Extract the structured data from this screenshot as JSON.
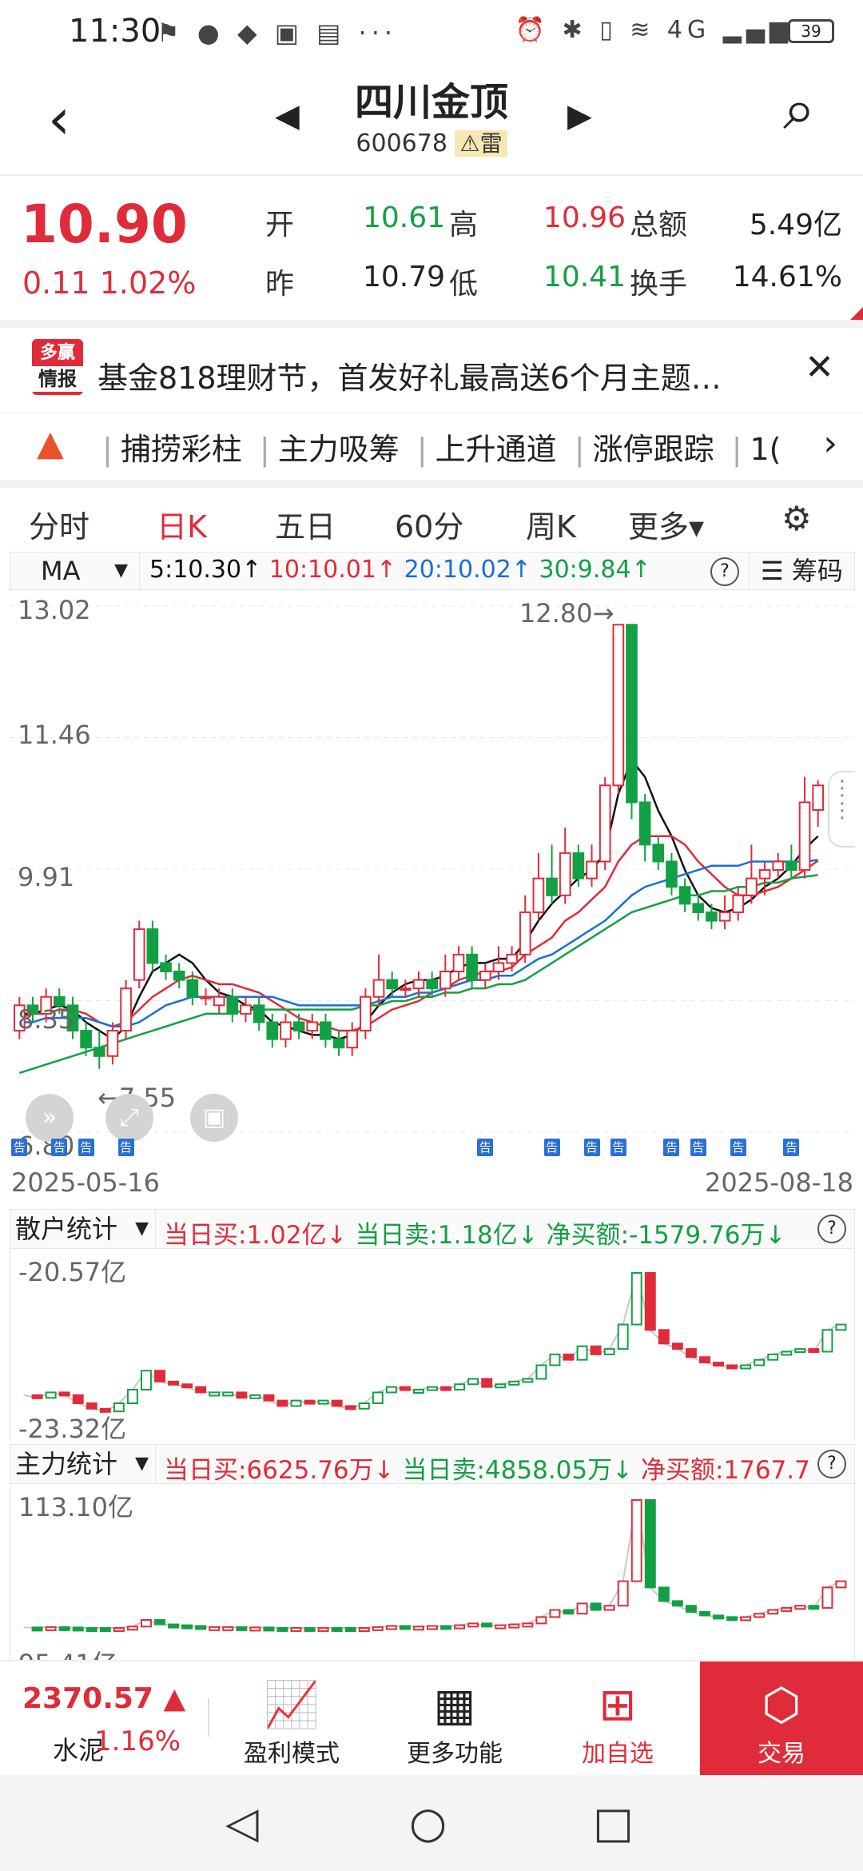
{
  "status_bar": {
    "time": "11:30",
    "battery": "39",
    "left_icons": "⚑ ● ◆ ▣ ▤ ···",
    "right_icons": "⏰ ✱ ▯ ≋ 4G ▂▄▆"
  },
  "header": {
    "back": "‹",
    "prev": "◀",
    "next": "▶",
    "title": "四川金顶",
    "code": "600678",
    "warning_label": "⚠雷",
    "search": "⌕"
  },
  "quote": {
    "price": "10.90",
    "change": "0.11 1.02%",
    "open_label": "开",
    "open": "10.61",
    "high_label": "高",
    "high": "10.96",
    "prev_label": "昨",
    "prev": "10.79",
    "low_label": "低",
    "low": "10.41",
    "amount_label": "总额",
    "amount": "5.49亿",
    "turnover_label": "换手",
    "turnover": "14.61%"
  },
  "ad": {
    "badge_top": "多赢",
    "badge_bottom": "情报",
    "text": "基金818理财节，首发好礼最高送6个月主题…",
    "close": "✕"
  },
  "tags": {
    "items": [
      "捕捞彩柱",
      "主力吸筹",
      "上升通道",
      "涨停跟踪",
      "1("
    ],
    "more": "›"
  },
  "tabs": [
    "分时",
    "日K",
    "五日",
    "60分",
    "周K",
    "更多▾"
  ],
  "settings_icon": "⚙",
  "ma_bar": {
    "selector": "MA",
    "ma5": "5:10.30↑",
    "ma10": "10:10.01↑",
    "ma20": "20:10.02↑",
    "ma30": "30:9.84↑",
    "help": "?",
    "chip": "筹码"
  },
  "chart_data": {
    "type": "candlestick",
    "ylim": [
      6.8,
      13.02
    ],
    "y_ticks": [
      "13.02",
      "11.46",
      "9.91",
      "8.35",
      "6.80"
    ],
    "max_label": "12.80→",
    "min_label": "←7.55",
    "x_start": "2025-05-16",
    "x_end": "2025-08-18",
    "candles": [
      [
        8.0,
        8.3,
        7.9,
        8.4
      ],
      [
        8.3,
        8.2,
        8.1,
        8.4
      ],
      [
        8.2,
        8.4,
        8.1,
        8.5
      ],
      [
        8.4,
        8.3,
        8.2,
        8.5
      ],
      [
        8.3,
        8.0,
        7.9,
        8.4
      ],
      [
        8.0,
        7.8,
        7.7,
        8.1
      ],
      [
        7.8,
        7.7,
        7.55,
        8.0
      ],
      [
        7.7,
        8.0,
        7.6,
        8.1
      ],
      [
        8.0,
        8.5,
        7.9,
        8.6
      ],
      [
        8.6,
        9.2,
        8.5,
        9.3
      ],
      [
        9.2,
        8.8,
        8.7,
        9.3
      ],
      [
        8.8,
        8.7,
        8.6,
        8.9
      ],
      [
        8.7,
        8.6,
        8.5,
        8.8
      ],
      [
        8.6,
        8.4,
        8.3,
        8.7
      ],
      [
        8.4,
        8.4,
        8.3,
        8.5
      ],
      [
        8.3,
        8.4,
        8.2,
        8.5
      ],
      [
        8.4,
        8.2,
        8.1,
        8.5
      ],
      [
        8.2,
        8.3,
        8.1,
        8.4
      ],
      [
        8.3,
        8.1,
        8.0,
        8.4
      ],
      [
        8.1,
        7.9,
        7.8,
        8.2
      ],
      [
        7.9,
        8.1,
        7.8,
        8.2
      ],
      [
        8.1,
        8.0,
        7.9,
        8.2
      ],
      [
        8.0,
        8.1,
        7.9,
        8.2
      ],
      [
        8.1,
        7.9,
        7.8,
        8.2
      ],
      [
        7.9,
        7.8,
        7.7,
        8.0
      ],
      [
        7.8,
        8.0,
        7.7,
        8.1
      ],
      [
        8.0,
        8.4,
        7.9,
        8.5
      ],
      [
        8.4,
        8.6,
        8.3,
        8.9
      ],
      [
        8.6,
        8.5,
        8.4,
        8.7
      ],
      [
        8.5,
        8.5,
        8.4,
        8.6
      ],
      [
        8.5,
        8.6,
        8.4,
        8.7
      ],
      [
        8.6,
        8.5,
        8.4,
        8.7
      ],
      [
        8.5,
        8.7,
        8.4,
        8.9
      ],
      [
        8.7,
        8.9,
        8.6,
        9.0
      ],
      [
        8.9,
        8.6,
        8.5,
        9.0
      ],
      [
        8.6,
        8.7,
        8.5,
        8.8
      ],
      [
        8.7,
        8.8,
        8.6,
        9.0
      ],
      [
        8.8,
        8.9,
        8.7,
        9.0
      ],
      [
        8.9,
        9.4,
        8.8,
        9.6
      ],
      [
        9.4,
        9.8,
        9.3,
        10.1
      ],
      [
        9.8,
        9.6,
        9.5,
        10.2
      ],
      [
        9.6,
        10.1,
        9.5,
        10.4
      ],
      [
        10.1,
        9.8,
        9.7,
        10.2
      ],
      [
        9.8,
        10.0,
        9.7,
        10.2
      ],
      [
        10.0,
        10.9,
        9.9,
        11.0
      ],
      [
        10.9,
        12.8,
        10.8,
        12.8
      ],
      [
        12.8,
        10.7,
        10.5,
        12.8
      ],
      [
        10.7,
        10.2,
        10.0,
        10.8
      ],
      [
        10.2,
        10.0,
        9.9,
        10.3
      ],
      [
        10.0,
        9.7,
        9.6,
        10.1
      ],
      [
        9.7,
        9.5,
        9.4,
        9.8
      ],
      [
        9.5,
        9.4,
        9.3,
        9.6
      ],
      [
        9.4,
        9.3,
        9.2,
        9.5
      ],
      [
        9.3,
        9.4,
        9.2,
        9.6
      ],
      [
        9.4,
        9.6,
        9.3,
        9.7
      ],
      [
        9.6,
        9.8,
        9.5,
        10.2
      ],
      [
        9.8,
        9.9,
        9.6,
        10.0
      ],
      [
        9.9,
        10.0,
        9.8,
        10.1
      ],
      [
        10.0,
        9.9,
        9.8,
        10.2
      ],
      [
        9.9,
        10.7,
        9.8,
        11.0
      ],
      [
        10.61,
        10.9,
        10.41,
        10.96
      ]
    ],
    "ma_series": [
      {
        "name": "5",
        "color": "#111111",
        "values": [
          8.2,
          8.2,
          8.25,
          8.3,
          8.25,
          8.1,
          8.0,
          7.9,
          8.05,
          8.4,
          8.7,
          8.8,
          8.9,
          8.8,
          8.6,
          8.45,
          8.4,
          8.3,
          8.25,
          8.1,
          8.05,
          8.0,
          7.95,
          7.95,
          7.9,
          7.95,
          8.1,
          8.3,
          8.45,
          8.55,
          8.6,
          8.6,
          8.65,
          8.75,
          8.8,
          8.8,
          8.85,
          8.85,
          9.05,
          9.3,
          9.5,
          9.65,
          9.8,
          9.9,
          10.1,
          10.8,
          11.2,
          11.0,
          10.6,
          10.3,
          9.9,
          9.6,
          9.45,
          9.4,
          9.45,
          9.55,
          9.7,
          9.8,
          9.95,
          10.15,
          10.3
        ]
      },
      {
        "name": "10",
        "color": "#e02c3a",
        "values": [
          8.15,
          8.2,
          8.2,
          8.25,
          8.25,
          8.2,
          8.1,
          8.05,
          8.1,
          8.25,
          8.4,
          8.5,
          8.6,
          8.65,
          8.6,
          8.55,
          8.55,
          8.5,
          8.45,
          8.35,
          8.25,
          8.15,
          8.1,
          8.05,
          8.0,
          8.0,
          8.05,
          8.15,
          8.25,
          8.3,
          8.35,
          8.45,
          8.5,
          8.6,
          8.65,
          8.7,
          8.7,
          8.75,
          8.9,
          9.0,
          9.1,
          9.3,
          9.4,
          9.55,
          9.7,
          10.0,
          10.2,
          10.3,
          10.3,
          10.3,
          10.2,
          10.0,
          9.85,
          9.7,
          9.6,
          9.6,
          9.65,
          9.7,
          9.8,
          9.9,
          10.01
        ]
      },
      {
        "name": "20",
        "color": "#1a6fd6",
        "values": [
          8.1,
          8.1,
          8.15,
          8.15,
          8.15,
          8.15,
          8.1,
          8.05,
          8.05,
          8.1,
          8.2,
          8.3,
          8.35,
          8.4,
          8.4,
          8.4,
          8.4,
          8.4,
          8.4,
          8.4,
          8.35,
          8.3,
          8.3,
          8.3,
          8.3,
          8.3,
          8.3,
          8.35,
          8.4,
          8.4,
          8.45,
          8.45,
          8.5,
          8.55,
          8.6,
          8.6,
          8.65,
          8.65,
          8.75,
          8.85,
          8.9,
          9.0,
          9.1,
          9.2,
          9.3,
          9.45,
          9.6,
          9.7,
          9.75,
          9.8,
          9.85,
          9.9,
          9.95,
          9.95,
          9.95,
          10.0,
          10.0,
          10.0,
          10.0,
          10.0,
          10.02
        ]
      },
      {
        "name": "30",
        "color": "#13a044",
        "values": [
          7.5,
          7.55,
          7.6,
          7.65,
          7.7,
          7.75,
          7.8,
          7.85,
          7.9,
          7.95,
          8.0,
          8.05,
          8.1,
          8.15,
          8.2,
          8.2,
          8.2,
          8.25,
          8.25,
          8.25,
          8.25,
          8.25,
          8.25,
          8.25,
          8.25,
          8.25,
          8.3,
          8.3,
          8.35,
          8.35,
          8.4,
          8.4,
          8.45,
          8.45,
          8.5,
          8.5,
          8.55,
          8.55,
          8.6,
          8.7,
          8.8,
          8.9,
          9.0,
          9.1,
          9.2,
          9.3,
          9.4,
          9.45,
          9.5,
          9.55,
          9.6,
          9.6,
          9.65,
          9.65,
          9.7,
          9.7,
          9.75,
          9.75,
          9.8,
          9.82,
          9.84
        ]
      }
    ],
    "announce_label": "告",
    "announce_index": [
      0,
      3,
      5,
      8,
      35,
      40,
      43,
      45,
      49,
      51,
      54,
      58
    ]
  },
  "retail": {
    "selector": "散户统计",
    "buy": "当日买:1.02亿↓",
    "sell": "当日卖:1.18亿↓",
    "net": "净买额:-1579.76万↓",
    "top_label": "-20.57亿",
    "bottom_label": "-23.32亿"
  },
  "main_force": {
    "selector": "主力统计",
    "buy": "当日买:6625.76万↓",
    "sell": "当日卖:4858.05万↓",
    "net": "净买额:1767.7",
    "top_label": "113.10亿",
    "bottom_label": "95.41亿"
  },
  "bottom_bar": {
    "index_value": "2370.57 ▲",
    "index_name": "水泥",
    "index_pct": "1.16%",
    "btn1_icon": "📈",
    "btn1": "盈利模式",
    "btn2_icon": "▦",
    "btn2": "更多功能",
    "btn3_icon": "⊞",
    "btn3": "加自选",
    "trade_icon": "⬡",
    "trade": "交易"
  },
  "nav": {
    "back": "◁",
    "home": "○",
    "recent": "□"
  }
}
